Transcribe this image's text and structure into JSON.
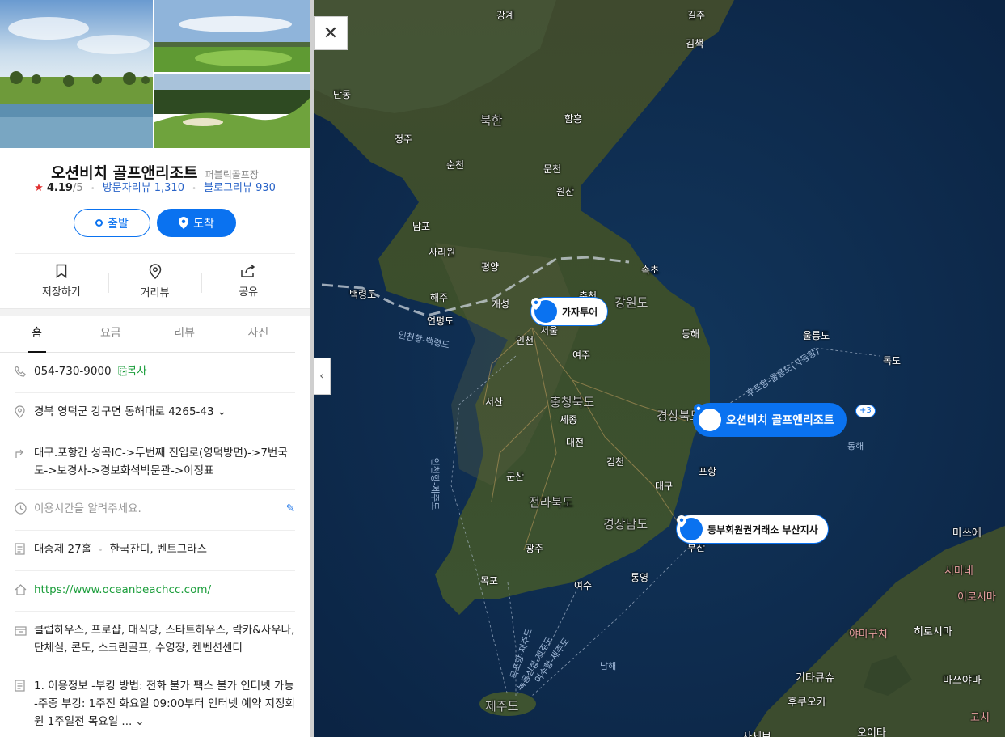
{
  "place": {
    "name": "오션비치 골프앤리조트",
    "category": "퍼블릭골프장",
    "rating": "4.19",
    "rating_max": "/5",
    "visitor_review_label": "방문자리뷰 1,310",
    "blog_review_label": "블로그리뷰 930"
  },
  "route": {
    "start_label": "출발",
    "arrive_label": "도착"
  },
  "actions": [
    {
      "label": "저장하기",
      "icon": "bookmark-icon"
    },
    {
      "label": "거리뷰",
      "icon": "location-icon"
    },
    {
      "label": "공유",
      "icon": "share-icon"
    }
  ],
  "tabs": [
    "홈",
    "요금",
    "리뷰",
    "사진"
  ],
  "active_tab": "홈",
  "info": {
    "phone": "054-730-9000",
    "copy_label": "복사",
    "address": "경북 영덕군 강구면 동해대로 4265-43",
    "directions": "대구.포항간 성곡IC->두번째 진입로(영덕방면)->7번국도->보경사->경보화석박문관->이정표",
    "hours_placeholder": "이용시간을 알려주세요.",
    "course_holes": "대중제 27홀",
    "course_grass": "한국잔디, 벤트그라스",
    "website": "https://www.oceanbeachcc.com/",
    "facilities": "클럽하우스, 프로샵, 대식당, 스타트하우스, 락카&사우나, 단체실, 콘도, 스크린골프, 수영장, 켄벤션센터",
    "notice": "1. 이용정보 -부킹 방법: 전화 불가 팩스 불가 인터넷 가능 -주중 부킹: 1주전 화요일 09:00부터 인터넷 예약 지정회원 1주일전 목요일 ..."
  },
  "map": {
    "labels": [
      {
        "text": "강계"
      },
      {
        "text": "길주"
      },
      {
        "text": "김책"
      },
      {
        "text": "단동"
      },
      {
        "text": "북한"
      },
      {
        "text": "함흥"
      },
      {
        "text": "정주"
      },
      {
        "text": "순천"
      },
      {
        "text": "문천"
      },
      {
        "text": "원산"
      },
      {
        "text": "남포"
      },
      {
        "text": "사리원"
      },
      {
        "text": "평양"
      },
      {
        "text": "속초"
      },
      {
        "text": "백령도"
      },
      {
        "text": "해주"
      },
      {
        "text": "개성"
      },
      {
        "text": "춘천"
      },
      {
        "text": "강원도"
      },
      {
        "text": "연평도"
      },
      {
        "text": "서울"
      },
      {
        "text": "인천"
      },
      {
        "text": "여주"
      },
      {
        "text": "동해"
      },
      {
        "text": "울릉도"
      },
      {
        "text": "독도"
      },
      {
        "text": "인천항-백령도"
      },
      {
        "text": "서산"
      },
      {
        "text": "충청북도"
      },
      {
        "text": "세종"
      },
      {
        "text": "대전"
      },
      {
        "text": "경상북도"
      },
      {
        "text": "김천"
      },
      {
        "text": "군산"
      },
      {
        "text": "포항"
      },
      {
        "text": "대구"
      },
      {
        "text": "전라북도"
      },
      {
        "text": "경상남도"
      },
      {
        "text": "광주"
      },
      {
        "text": "부산"
      },
      {
        "text": "목포"
      },
      {
        "text": "여수"
      },
      {
        "text": "통영"
      },
      {
        "text": "남해"
      },
      {
        "text": "제주도"
      },
      {
        "text": "동해"
      },
      {
        "text": "마쓰에"
      },
      {
        "text": "시마네"
      },
      {
        "text": "야마구치"
      },
      {
        "text": "히로시마"
      },
      {
        "text": "기타큐슈"
      },
      {
        "text": "후쿠오카"
      },
      {
        "text": "마쓰야마"
      },
      {
        "text": "오이타"
      },
      {
        "text": "고치"
      },
      {
        "text": "사세보"
      },
      {
        "text": "이로시마"
      },
      {
        "text": "후포항-울릉도(사동항)"
      },
      {
        "text": "인천항-제주도"
      },
      {
        "text": "목포항-제주도"
      },
      {
        "text": "녹동신항-제주도"
      },
      {
        "text": "여수항-제주도"
      }
    ],
    "pins": [
      {
        "label": "가자투어"
      },
      {
        "label": "오션비치 골프앤리조트",
        "extra": "+3"
      },
      {
        "label": "동부회원권거래소 부산지사"
      }
    ]
  },
  "colors": {
    "accent": "#0a72f0",
    "copy_green": "#1a9d3a",
    "link_blue": "#2a64c8",
    "star_red": "#e03030"
  }
}
